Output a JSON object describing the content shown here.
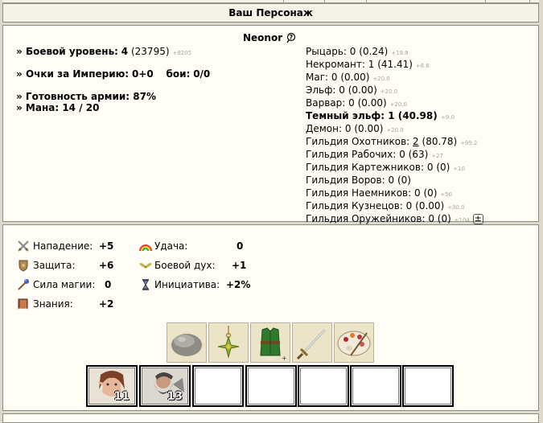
{
  "title": "Ваш Персонаж",
  "nickname": "Neonor",
  "left_stats": {
    "combat_level_label": "Боевой уровень:",
    "combat_level": "4",
    "combat_exp": "(23795)",
    "combat_exp_next": "+8205",
    "empire_label": "Очки за Империю:",
    "empire_value": "0+0",
    "fights_label": "бои:",
    "fights_value": "0/0",
    "army_ready": "» Готовность армии: 87%",
    "mana": "» Мана: 14 / 20"
  },
  "factions": [
    {
      "name": "Рыцарь:",
      "level": "0",
      "points": "(0.24)",
      "next": "+19.8",
      "bold": false
    },
    {
      "name": "Некромант:",
      "level": "1",
      "points": "(41.41)",
      "next": "+8.6",
      "bold": false
    },
    {
      "name": "Маг:",
      "level": "0",
      "points": "(0.00)",
      "next": "+20.0",
      "bold": false
    },
    {
      "name": "Эльф:",
      "level": "0",
      "points": "(0.00)",
      "next": "+20.0",
      "bold": false
    },
    {
      "name": "Варвар:",
      "level": "0",
      "points": "(0.00)",
      "next": "+20.0",
      "bold": false
    },
    {
      "name": "Темный эльф:",
      "level": "1",
      "points": "(40.98)",
      "next": "+9.0",
      "bold": true
    },
    {
      "name": "Демон:",
      "level": "0",
      "points": "(0.00)",
      "next": "+20.0",
      "bold": false
    }
  ],
  "guilds": [
    {
      "name": "Гильдия Охотников:",
      "level": "2",
      "points": "(80.78)",
      "next": "+99.2",
      "underline": true
    },
    {
      "name": "Гильдия Рабочих:",
      "level": "0",
      "points": "(63)",
      "next": "+27",
      "underline": false
    },
    {
      "name": "Гильдия Картежников:",
      "level": "0",
      "points": "(0)",
      "next": "+10",
      "underline": false
    },
    {
      "name": "Гильдия Воров:",
      "level": "0",
      "points": "(0)",
      "next": "",
      "underline": false
    },
    {
      "name": "Гильдия Наемников:",
      "level": "0",
      "points": "(0)",
      "next": "+50",
      "underline": false
    },
    {
      "name": "Гильдия Кузнецов:",
      "level": "0",
      "points": "(0.00)",
      "next": "+30.0",
      "underline": false
    },
    {
      "name": "Гильдия Оружейников:",
      "level": "0",
      "points": "(0)",
      "next": "+104",
      "underline": false
    }
  ],
  "guild_expand": "±",
  "attributes": [
    {
      "label": "Нападение:",
      "value": "+5",
      "icon": "crossed-swords-icon",
      "color": "#8b8b8b"
    },
    {
      "label": "Защита:",
      "value": "+6",
      "icon": "shield-icon",
      "color": "#b08a4a"
    },
    {
      "label": "Сила магии:",
      "value": "0",
      "icon": "magic-wand-icon",
      "color": "#3c5ec8"
    },
    {
      "label": "Знания:",
      "value": "+2",
      "icon": "book-icon",
      "color": "#a0522d"
    }
  ],
  "attributes_right": [
    {
      "label": "Удача:",
      "value": "0",
      "icon": "rainbow-icon"
    },
    {
      "label": "Боевой дух:",
      "value": "+1",
      "icon": "wings-icon"
    },
    {
      "label": "Инициатива:",
      "value": "+2%",
      "icon": "hourglass-icon"
    }
  ],
  "artifacts": [
    "stone-artifact",
    "amulet-artifact",
    "green-armor-artifact",
    "sword-artifact",
    "palette-artifact"
  ],
  "army": [
    {
      "name": "elf-unit",
      "count": "11"
    },
    {
      "name": "dwarf-unit",
      "count": "13"
    },
    {
      "name": "empty",
      "count": ""
    },
    {
      "name": "empty",
      "count": ""
    },
    {
      "name": "empty",
      "count": ""
    },
    {
      "name": "empty",
      "count": ""
    },
    {
      "name": "empty",
      "count": ""
    }
  ]
}
